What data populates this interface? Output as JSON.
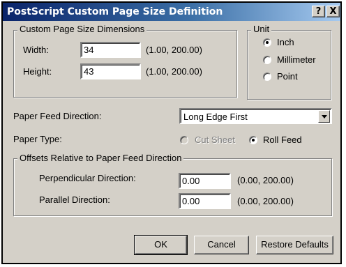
{
  "window": {
    "title": "PostScript Custom Page Size Definition",
    "help_btn": "?",
    "close_btn": "X"
  },
  "dimensions": {
    "legend": "Custom Page Size Dimensions",
    "width_label": "Width:",
    "width_value": "34",
    "width_range": "(1.00, 200.00)",
    "height_label": "Height:",
    "height_value": "43",
    "height_range": "(1.00, 200.00)"
  },
  "unit": {
    "legend": "Unit",
    "options": [
      {
        "label": "Inch",
        "selected": true
      },
      {
        "label": "Millimeter",
        "selected": false
      },
      {
        "label": "Point",
        "selected": false
      }
    ]
  },
  "paper_feed": {
    "label": "Paper Feed Direction:",
    "value": "Long Edge First"
  },
  "paper_type": {
    "label": "Paper Type:",
    "cut_sheet": "Cut Sheet",
    "cut_sheet_enabled": false,
    "roll_feed": "Roll Feed",
    "roll_feed_selected": true
  },
  "offsets": {
    "legend": "Offsets Relative to Paper Feed Direction",
    "perp_label": "Perpendicular Direction:",
    "perp_value": "0.00",
    "perp_range": "(0.00, 200.00)",
    "para_label": "Parallel Direction:",
    "para_value": "0.00",
    "para_range": "(0.00, 200.00)"
  },
  "buttons": {
    "ok": "OK",
    "cancel": "Cancel",
    "restore": "Restore Defaults"
  }
}
